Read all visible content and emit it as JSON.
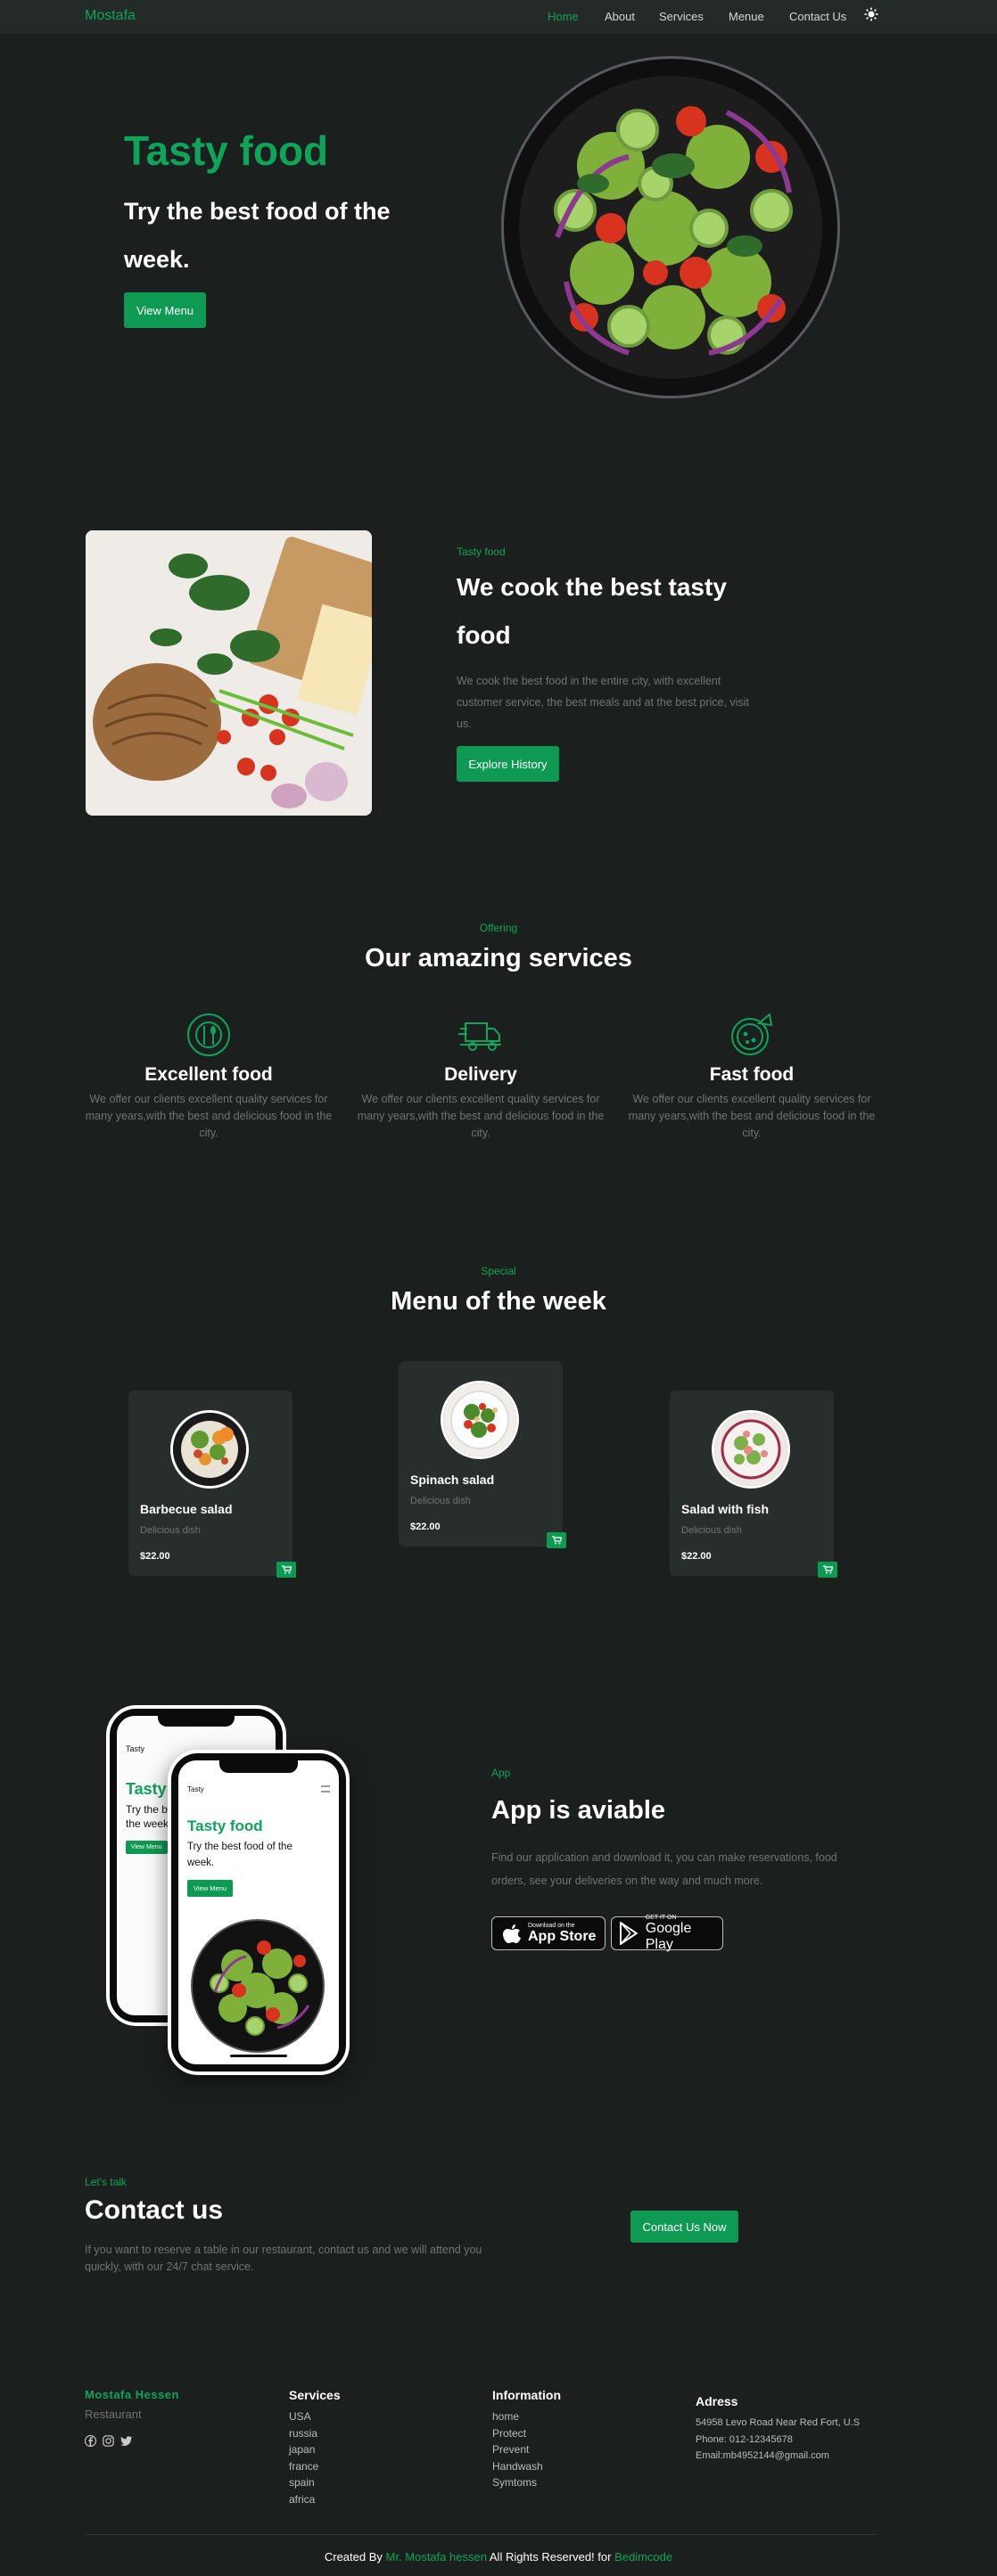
{
  "header": {
    "logo": "Mostafa",
    "nav": [
      "Home",
      "About",
      "Services",
      "Menue",
      "Contact Us"
    ],
    "theme_icon": "sun-icon"
  },
  "hero": {
    "title": "Tasty food",
    "subtitle": "Try the best food of the week.",
    "button": "View Menu"
  },
  "about": {
    "label": "Tasty food",
    "title": "We cook the best tasty food",
    "text": "We cook the best food in the entire city, with excellent customer service, the best meals and at the best price, visit us.",
    "button": "Explore History"
  },
  "services": {
    "label": "Offering",
    "title": "Our amazing services",
    "items": [
      {
        "icon": "dish-utensils-icon",
        "title": "Excellent food",
        "text": "We offer our clients excellent quality services for many years,with the best and delicious food in the city."
      },
      {
        "icon": "delivery-truck-icon",
        "title": "Delivery",
        "text": "We offer our clients excellent quality services for many years,with the best and delicious food in the city."
      },
      {
        "icon": "pizza-icon",
        "title": "Fast food",
        "text": "We offer our clients excellent quality services for many years,with the best and delicious food in the city."
      }
    ]
  },
  "menu": {
    "label": "Special",
    "title": "Menu of the week",
    "items": [
      {
        "name": "Barbecue salad",
        "desc": "Delicious dish",
        "price": "$22.00"
      },
      {
        "name": "Spinach salad",
        "desc": "Delicious dish",
        "price": "$22.00"
      },
      {
        "name": "Salad with fish",
        "desc": "Delicious dish",
        "price": "$22.00"
      }
    ]
  },
  "app": {
    "label": "App",
    "title": "App is aviable",
    "text": "Find our application and download it, you can make reservations, food orders, see your deliveries on the way and much more.",
    "appstore_small": "Download on the",
    "appstore_big": "App Store",
    "googleplay_small": "GET IT ON",
    "googleplay_big": "Google Play",
    "phone": {
      "brand": "Tasty",
      "title": "Tasty food",
      "subtitle": "Try the best food of the week.",
      "button": "View Menu",
      "back_title": "Tasty",
      "back_sub": "Try the b",
      "back_sub2": "the week",
      "back_button": "View Menu"
    }
  },
  "contact": {
    "label": "Let's talk",
    "title": "Contact us",
    "text": "If you want to reserve a table in our restaurant, contact us and we will attend you quickly, with our 24/7 chat service.",
    "button": "Contact Us Now"
  },
  "footer": {
    "brand": "Mostafa Hessen",
    "brand_sub": "Restaurant",
    "socials": [
      "facebook-icon",
      "instagram-icon",
      "twitter-icon"
    ],
    "services_title": "Services",
    "services": [
      "USA",
      "russia",
      "japan",
      "france",
      "spain",
      "africa"
    ],
    "info_title": "Information",
    "info": [
      "home",
      "Protect",
      "Prevent",
      "Handwash",
      "Symtoms"
    ],
    "address_title": "Adress",
    "address": [
      "54958 Levo Road Near Red Fort, U.S",
      "Phone: 012-12345678",
      "Email:mb4952144@gmail.com"
    ],
    "credit_prefix": "Created By",
    "credit_name": "Mr. Mostafa hessen",
    "credit_mid": "All Rights Reserved! for",
    "credit_site": "Bedimcode"
  },
  "colors": {
    "accent": "#0ea45a",
    "background": "#1b201e",
    "card": "#282e2b"
  }
}
